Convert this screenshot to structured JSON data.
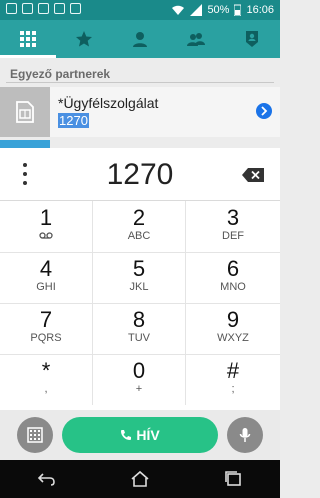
{
  "status_bar": {
    "battery": "50%",
    "time": "16:06",
    "icons": [
      "notification-icon",
      "gallery-icon",
      "email-icon",
      "cast-icon",
      "sim-icon",
      "wifi-icon",
      "signal-icon",
      "battery-icon"
    ]
  },
  "tabs": [
    {
      "name": "dialpad-tab",
      "icon": "grid-icon",
      "active": true
    },
    {
      "name": "favorites-tab",
      "icon": "star-icon",
      "active": false
    },
    {
      "name": "contacts-tab",
      "icon": "person-icon",
      "active": false
    },
    {
      "name": "groups-tab",
      "icon": "group-icon",
      "active": false
    },
    {
      "name": "profile-tab",
      "icon": "profile-shield-icon",
      "active": false
    }
  ],
  "match": {
    "section_title": "Egyező partnerek",
    "contact_name": "*Ügyfélszolgálat",
    "contact_number": "1270"
  },
  "dialer": {
    "entered_number": "1270",
    "keys": [
      {
        "main": "1",
        "sub": "voicemail-icon"
      },
      {
        "main": "2",
        "sub": "ABC"
      },
      {
        "main": "3",
        "sub": "DEF"
      },
      {
        "main": "4",
        "sub": "GHI"
      },
      {
        "main": "5",
        "sub": "JKL"
      },
      {
        "main": "6",
        "sub": "MNO"
      },
      {
        "main": "7",
        "sub": "PQRS"
      },
      {
        "main": "8",
        "sub": "TUV"
      },
      {
        "main": "9",
        "sub": "WXYZ"
      },
      {
        "main": "*",
        "sub": ","
      },
      {
        "main": "0",
        "sub": "+"
      },
      {
        "main": "#",
        "sub": ";"
      }
    ]
  },
  "actions": {
    "call_label": "HÍV"
  },
  "colors": {
    "teal_dark": "#1a8a8a",
    "teal": "#2aa1a1",
    "call_green": "#27c287",
    "highlight_blue": "#4a90e2"
  }
}
